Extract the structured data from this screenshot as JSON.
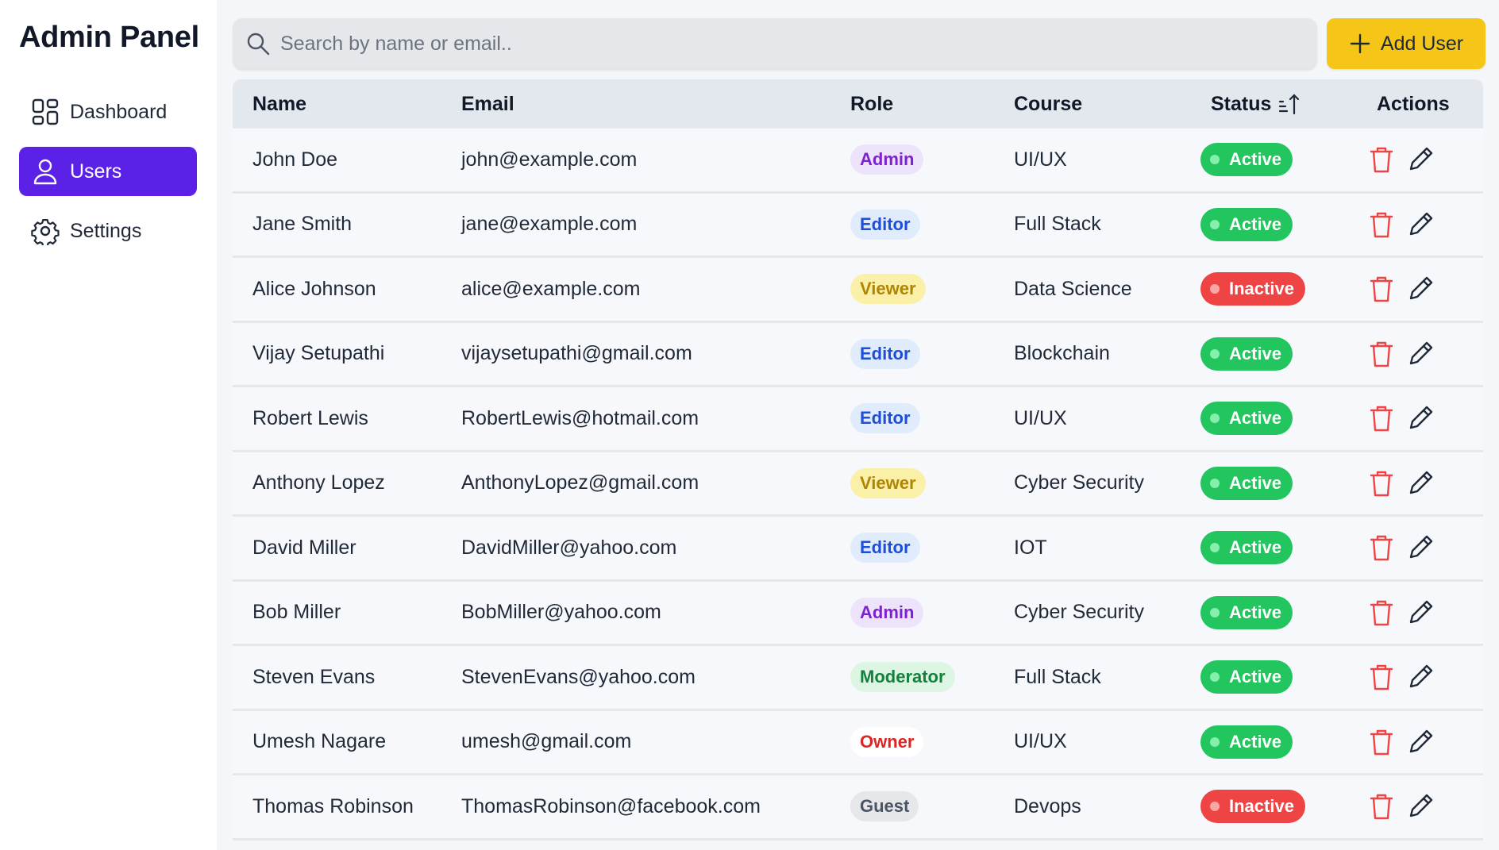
{
  "sidebar": {
    "title": "Admin Panel",
    "items": [
      {
        "label": "Dashboard",
        "icon": "dashboard-icon",
        "active": false
      },
      {
        "label": "Users",
        "icon": "user-icon",
        "active": true
      },
      {
        "label": "Settings",
        "icon": "gear-icon",
        "active": false
      }
    ]
  },
  "search": {
    "placeholder": "Search by name or email.."
  },
  "toolbar": {
    "add_label": "Add User"
  },
  "table": {
    "headers": {
      "name": "Name",
      "email": "Email",
      "role": "Role",
      "course": "Course",
      "status": "Status",
      "actions": "Actions"
    },
    "rows": [
      {
        "name": "John Doe",
        "email": "john@example.com",
        "role": "Admin",
        "course": "UI/UX",
        "status": "Active"
      },
      {
        "name": "Jane Smith",
        "email": "jane@example.com",
        "role": "Editor",
        "course": "Full Stack",
        "status": "Active"
      },
      {
        "name": "Alice Johnson",
        "email": "alice@example.com",
        "role": "Viewer",
        "course": "Data Science",
        "status": "Inactive"
      },
      {
        "name": "Vijay Setupathi",
        "email": "vijaysetupathi@gmail.com",
        "role": "Editor",
        "course": "Blockchain",
        "status": "Active"
      },
      {
        "name": "Robert Lewis",
        "email": "RobertLewis@hotmail.com",
        "role": "Editor",
        "course": "UI/UX",
        "status": "Active"
      },
      {
        "name": "Anthony Lopez",
        "email": "AnthonyLopez@gmail.com",
        "role": "Viewer",
        "course": "Cyber Security",
        "status": "Active"
      },
      {
        "name": "David Miller",
        "email": "DavidMiller@yahoo.com",
        "role": "Editor",
        "course": "IOT",
        "status": "Active"
      },
      {
        "name": "Bob Miller",
        "email": "BobMiller@yahoo.com",
        "role": "Admin",
        "course": "Cyber Security",
        "status": "Active"
      },
      {
        "name": "Steven Evans",
        "email": "StevenEvans@yahoo.com",
        "role": "Moderator",
        "course": "Full Stack",
        "status": "Active"
      },
      {
        "name": "Umesh Nagare",
        "email": "umesh@gmail.com",
        "role": "Owner",
        "course": "UI/UX",
        "status": "Active"
      },
      {
        "name": "Thomas Robinson",
        "email": "ThomasRobinson@facebook.com",
        "role": "Guest",
        "course": "Devops",
        "status": "Inactive"
      }
    ]
  },
  "colors": {
    "accent": "#5b21e6",
    "add_button": "#f5c518",
    "status_active": "#22c55e",
    "status_inactive": "#ef4444",
    "delete_icon": "#ef4444"
  }
}
